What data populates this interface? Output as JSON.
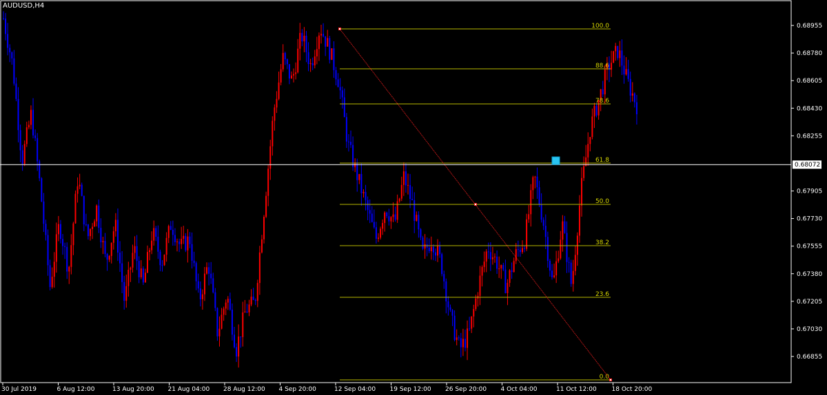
{
  "header": {
    "symbol_label": "AUDUSD,H4"
  },
  "colors": {
    "background": "#000000",
    "frame": "#ffffff",
    "bull_candle": "#ff0000",
    "bear_candle": "#0000ff",
    "fib_line": "#b8b800",
    "fib_text": "#d8d800",
    "trend_line": "#ff2020",
    "crosshair": "#ffffff",
    "marker": "#29c4f2"
  },
  "chart_data": {
    "type": "candlestick",
    "symbol": "AUDUSD",
    "timeframe": "H4",
    "price_axis": {
      "ticks": [
        "0.68955",
        "0.68780",
        "0.68605",
        "0.68430",
        "0.68255",
        "0.67905",
        "0.67730",
        "0.67555",
        "0.67380",
        "0.67205",
        "0.67030",
        "0.66855"
      ],
      "current_price": "0.68072"
    },
    "time_axis": {
      "ticks": [
        "30 Jul 2019",
        "6 Aug 12:00",
        "13 Aug 20:00",
        "21 Aug 04:00",
        "28 Aug 12:00",
        "4 Sep 20:00",
        "12 Sep 04:00",
        "19 Sep 12:00",
        "26 Sep 20:00",
        "4 Oct 04:00",
        "11 Oct 12:00",
        "18 Oct 20:00"
      ]
    },
    "fibonacci": {
      "levels": [
        "100.0",
        "88.6",
        "78.6",
        "61.8",
        "50.0",
        "38.2",
        "23.6",
        "0.0"
      ],
      "high": 0.6896,
      "low": 0.665
    },
    "price_path": [
      0.69,
      0.687,
      0.681,
      0.684,
      0.679,
      0.673,
      0.677,
      0.674,
      0.68,
      0.676,
      0.678,
      0.6745,
      0.677,
      0.672,
      0.6755,
      0.673,
      0.6765,
      0.6745,
      0.677,
      0.6755,
      0.676,
      0.672,
      0.6745,
      0.67,
      0.6725,
      0.669,
      0.6715,
      0.672,
      0.678,
      0.684,
      0.6875,
      0.686,
      0.689,
      0.687,
      0.6895,
      0.688,
      0.686,
      0.682,
      0.68,
      0.678,
      0.676,
      0.678,
      0.677,
      0.68,
      0.678,
      0.675,
      0.676,
      0.6745,
      0.671,
      0.669,
      0.67,
      0.673,
      0.6755,
      0.6745,
      0.673,
      0.675,
      0.676,
      0.68,
      0.677,
      0.673,
      0.677,
      0.673,
      0.679,
      0.683,
      0.685,
      0.687,
      0.688,
      0.686,
      0.6845
    ],
    "trend_line": {
      "from_price": 0.68955,
      "to_price": 0.665
    },
    "crosshair_price": 0.68072
  }
}
